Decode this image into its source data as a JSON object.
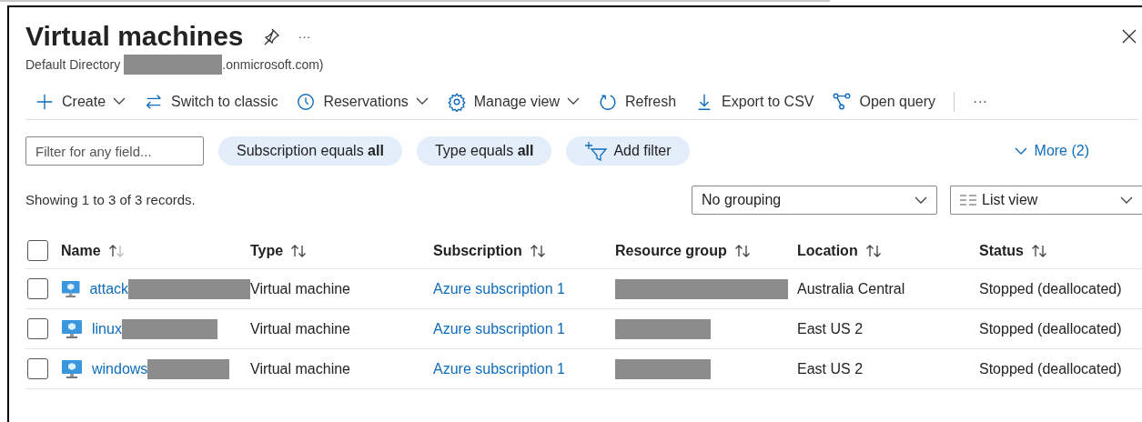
{
  "header": {
    "title": "Virtual machines",
    "subtitle_start": "Default Directory",
    "subtitle_end": ".onmicrosoft.com)",
    "more": "···"
  },
  "toolbar": [
    {
      "kind": "plus",
      "label": "Create",
      "dropdown": true
    },
    {
      "kind": "switch",
      "label": "Switch to classic",
      "dropdown": false
    },
    {
      "kind": "clock",
      "label": "Reservations",
      "dropdown": true
    },
    {
      "kind": "gear",
      "label": "Manage view",
      "dropdown": true
    },
    {
      "kind": "refresh",
      "label": "Refresh",
      "dropdown": false
    },
    {
      "kind": "download",
      "label": "Export to CSV",
      "dropdown": false
    },
    {
      "kind": "query",
      "label": "Open query",
      "dropdown": false
    }
  ],
  "toolbar_more": "···",
  "filter": {
    "placeholder": "Filter for any field..."
  },
  "pills": [
    {
      "kind": "equals",
      "text": "Subscription equals **all**"
    },
    {
      "kind": "equals",
      "text": "Type equals **all**"
    },
    {
      "kind": "add",
      "text": "Add filter"
    }
  ],
  "more_link": "More (2)",
  "records": "Showing 1 to 3 of 3 records.",
  "grouping": {
    "value": "No grouping"
  },
  "view": {
    "value": "List view"
  },
  "table": {
    "all_checked": false,
    "columns": [
      {
        "label": "Name",
        "sorted": true
      },
      {
        "label": "Type",
        "sorted": false
      },
      {
        "label": "Subscription",
        "sorted": false
      },
      {
        "label": "Resource group",
        "sorted": false
      },
      {
        "label": "Location",
        "sorted": false
      },
      {
        "label": "Status",
        "sorted": false
      }
    ],
    "rows": [
      {
        "name": "attack",
        "checked": false,
        "type": "Virtual machine",
        "subscription": "Azure subscription 1",
        "location": "Australia Central",
        "status": "Stopped (deallocated)"
      },
      {
        "name": "linux",
        "checked": false,
        "type": "Virtual machine",
        "subscription": "Azure subscription 1",
        "location": "East US 2",
        "status": "Stopped (deallocated)"
      },
      {
        "name": "windows",
        "checked": false,
        "type": "Virtual machine",
        "subscription": "Azure subscription 1",
        "location": "East US 2",
        "status": "Stopped (deallocated)"
      }
    ]
  }
}
